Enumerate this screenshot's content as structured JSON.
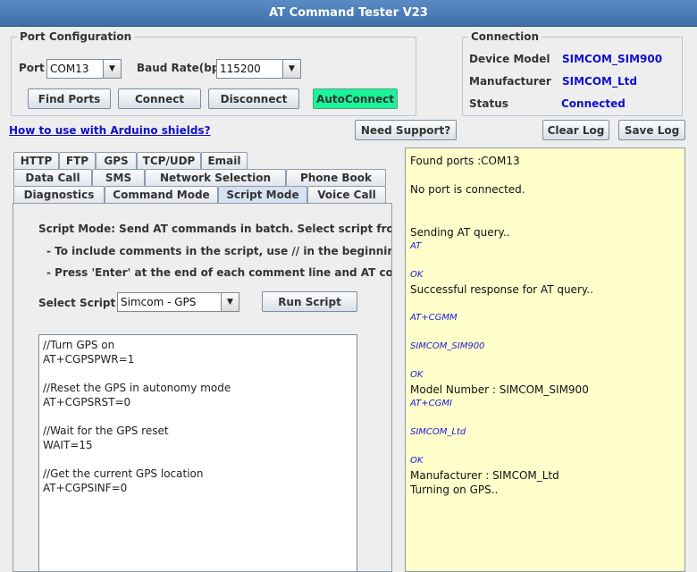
{
  "window": {
    "title": "AT Command Tester V23"
  },
  "port_config": {
    "title": "Port Configuration",
    "port_label": "Port",
    "port_value": "COM13",
    "baud_label": "Baud Rate(bps)",
    "baud_value": "115200",
    "buttons": {
      "find_ports": "Find Ports",
      "connect": "Connect",
      "disconnect": "Disconnect",
      "autoconnect": "AutoConnect"
    }
  },
  "connection": {
    "title": "Connection",
    "device_model_label": "Device Model",
    "device_model_value": "SIMCOM_SIM900",
    "manufacturer_label": "Manufacturer",
    "manufacturer_value": "SIMCOM_Ltd",
    "status_label": "Status",
    "status_value": "Connected"
  },
  "toolbar": {
    "arduino_link": "How to use with Arduino shields?",
    "need_support": "Need Support?",
    "clear_log": "Clear Log",
    "save_log": "Save Log"
  },
  "tabs": {
    "row1": [
      "HTTP",
      "FTP",
      "GPS",
      "TCP/UDP",
      "Email"
    ],
    "row2": [
      "Data Call",
      "SMS",
      "Network Selection",
      "Phone Book"
    ],
    "row3": [
      "Diagnostics",
      "Command Mode",
      "Script Mode",
      "Voice Call"
    ],
    "active": "Script Mode"
  },
  "script_mode": {
    "intro": "Script Mode: Send AT commands in batch. Select script from the drop",
    "note1": "- To include comments in the script, use // in the beginning of the line",
    "note2": "- Press 'Enter' at the end of each comment line and AT command line",
    "select_label": "Select Script",
    "select_value": "Simcom - GPS",
    "run_button": "Run Script",
    "script_text": "//Turn GPS on\nAT+CGPSPWR=1\n\n//Reset the GPS in autonomy mode\nAT+CGPSRST=0\n\n//Wait for the GPS reset\nWAIT=15\n\n//Get the current GPS location\nAT+CGPSINF=0"
  },
  "log": [
    {
      "text": "Found ports :COM13",
      "kind": "normal"
    },
    {
      "text": "",
      "kind": "normal"
    },
    {
      "text": "No port is connected.",
      "kind": "normal"
    },
    {
      "text": "",
      "kind": "normal"
    },
    {
      "text": "",
      "kind": "normal"
    },
    {
      "text": "Sending AT query..",
      "kind": "normal"
    },
    {
      "text": "AT",
      "kind": "cmd"
    },
    {
      "text": "",
      "kind": "normal"
    },
    {
      "text": "OK",
      "kind": "cmd"
    },
    {
      "text": "Successful response for AT query..",
      "kind": "normal"
    },
    {
      "text": "",
      "kind": "normal"
    },
    {
      "text": "AT+CGMM",
      "kind": "cmd"
    },
    {
      "text": "",
      "kind": "normal"
    },
    {
      "text": "SIMCOM_SIM900",
      "kind": "cmd"
    },
    {
      "text": "",
      "kind": "normal"
    },
    {
      "text": "OK",
      "kind": "cmd"
    },
    {
      "text": "Model Number : SIMCOM_SIM900",
      "kind": "normal"
    },
    {
      "text": "AT+CGMI",
      "kind": "cmd"
    },
    {
      "text": "",
      "kind": "normal"
    },
    {
      "text": "SIMCOM_Ltd",
      "kind": "cmd"
    },
    {
      "text": "",
      "kind": "normal"
    },
    {
      "text": "OK",
      "kind": "cmd"
    },
    {
      "text": "Manufacturer : SIMCOM_Ltd",
      "kind": "normal"
    },
    {
      "text": "Turning on GPS..",
      "kind": "normal"
    }
  ],
  "colors": {
    "title_bar": "#3f6fa8",
    "autoconnect": "#19f59a",
    "log_background": "#ffffcc",
    "link_blue": "#1010cc"
  },
  "icons": {
    "combo_arrow": "chevron-down-icon"
  }
}
